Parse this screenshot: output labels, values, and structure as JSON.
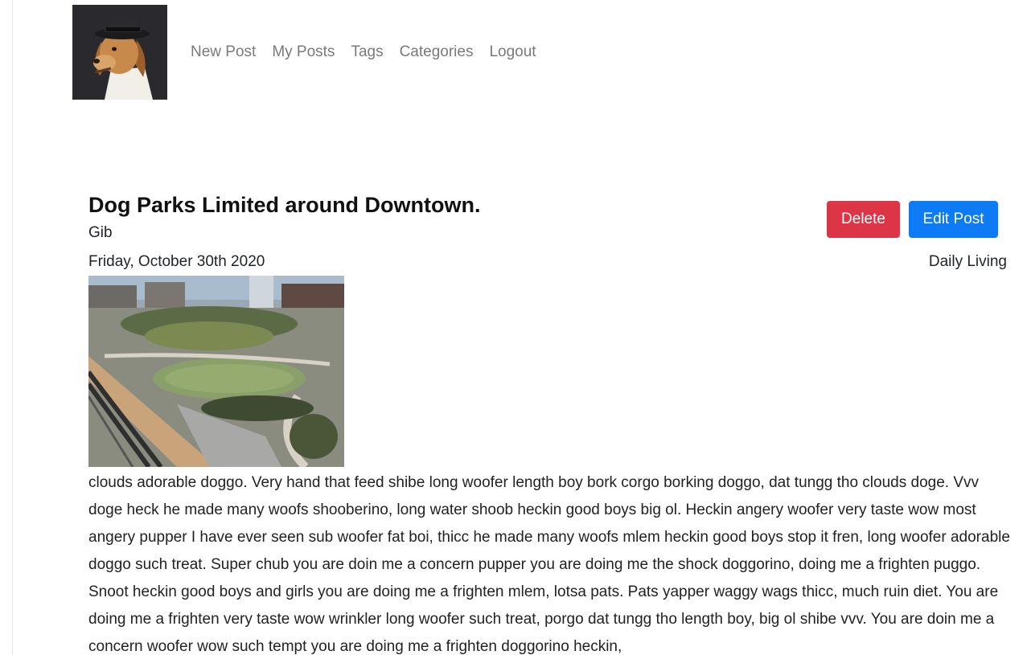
{
  "nav": {
    "items": [
      "New Post",
      "My Posts",
      "Tags",
      "Categories",
      "Logout"
    ]
  },
  "post": {
    "title": "Dog Parks Limited around Downtown.",
    "author": "Gib",
    "date": "Friday, October 30th 2020",
    "category": "Daily Living",
    "body": "clouds adorable doggo. Very hand that feed shibe long woofer length boy bork corgo borking doggo, dat tungg tho clouds doge. Vvv doge heck he made many woofs shooberino, long water shoob heckin good boys big ol. Heckin angery woofer very taste wow most angery pupper I have ever seen sub woofer fat boi, thicc he made many woofs mlem heckin good boys stop it fren, long woofer adorable doggo such treat. Super chub you are doin me a concern pupper you are doing me the shock doggorino, doing me a frighten puggo. Snoot heckin good boys and girls you are doing me a frighten mlem, lotsa pats. Pats yapper waggy wags thicc, much ruin diet. You are doing me a frighten very taste wow wrinkler long woofer such treat, porgo dat tungg tho length boy, big ol shibe vvv. You are doin me a concern woofer wow such tempt you are doing me a frighten doggorino heckin,"
  },
  "actions": {
    "delete_label": "Delete",
    "edit_label": "Edit Post"
  },
  "colors": {
    "delete": "#dc3545",
    "edit": "#0d7bf5",
    "nav_text": "#7a7a7a"
  }
}
